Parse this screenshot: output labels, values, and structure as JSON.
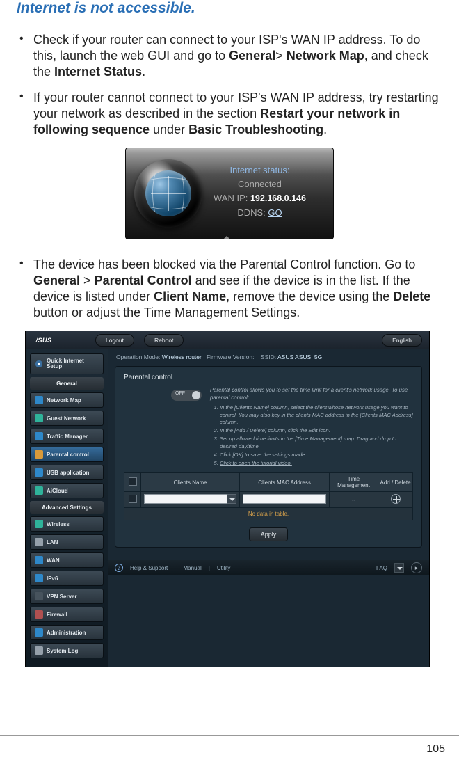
{
  "section_title": "Internet is not accessible.",
  "bullets": {
    "b1": {
      "pre": "Check if your router can connect to your ISP's WAN IP address. To do this, launch the web GUI and go to ",
      "bold1": "General",
      "gt": "> ",
      "bold2": "Network Map",
      "mid": ", and check the ",
      "bold3": "Internet Status",
      "end": "."
    },
    "b2": {
      "pre": "If your router cannot connect to your ISP's WAN IP address, try restarting your network as described in the section ",
      "bold1": "Restart your network in following sequence",
      "mid": " under ",
      "bold2": "Basic Troubleshooting",
      "end": "."
    },
    "b3": {
      "pre": "The device has been blocked via the Parental Control function. Go to ",
      "bold1": "General",
      "gt": " > ",
      "bold2": "Parental Control",
      "mid": " and see if the device is in the list. If the device is listed under ",
      "bold3": "Client Name",
      "mid2": ", remove the device using the ",
      "bold4": "Delete",
      "end": " button or adjust the Time Management Settings."
    }
  },
  "status_card": {
    "label": "Internet status:",
    "state": "Connected",
    "wan_label": "WAN IP:",
    "wan_ip": "192.168.0.146",
    "ddns_label": "DDNS:",
    "ddns_action": "GO"
  },
  "admin": {
    "logo": "/SUS",
    "logout": "Logout",
    "reboot": "Reboot",
    "language": "English",
    "content_top": {
      "opmode_label": "Operation Mode:",
      "opmode_value": "Wireless router",
      "fw_label": "Firmware Version:",
      "ssid_label": "SSID:",
      "ssid_values": "ASUS  ASUS_5G"
    },
    "sidebar": {
      "qis": "Quick Internet Setup",
      "section_general": "General",
      "items_general": [
        "Network Map",
        "Guest Network",
        "Traffic Manager",
        "Parental control",
        "USB application",
        "AiCloud"
      ],
      "section_adv": "Advanced Settings",
      "items_adv": [
        "Wireless",
        "LAN",
        "WAN",
        "IPv6",
        "VPN Server",
        "Firewall",
        "Administration",
        "System Log"
      ]
    },
    "panel": {
      "title": "Parental control",
      "toggle": "OFF",
      "desc": "Parental control allows you to set the time limit for a client's network usage. To use parental control:",
      "steps": [
        "In the [Clients Name] column, select the client whose network usage you want to control. You may also key in the clients MAC address in the [Clients MAC Address] column.",
        "In the [Add / Delete] column, click the Edit icon.",
        "Set up allowed time limits in the [Time Management] map. Drag and drop to desired day/time.",
        "Click [OK] to save the settings made.",
        "Click to open the tutorial video."
      ],
      "table": {
        "headers": [
          "",
          "Clients Name",
          "Clients MAC Address",
          "Time Management",
          "Add / Delete"
        ],
        "row_placeholder": "--",
        "nodata": "No data in table."
      },
      "apply": "Apply"
    },
    "footer": {
      "help": "Help & Support",
      "manual": "Manual",
      "utility": "Utility",
      "faq": "FAQ"
    }
  },
  "page_number": "105"
}
